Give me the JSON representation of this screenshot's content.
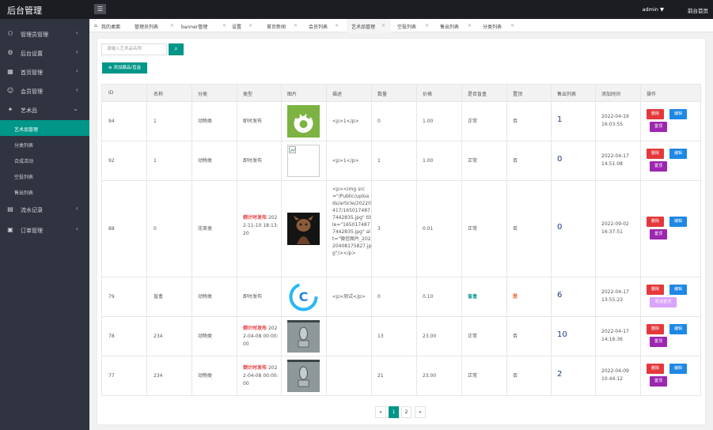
{
  "header": {
    "logo": "后台管理",
    "menu_icon": "☰",
    "user": "admin",
    "user_arrow": "▼",
    "home": "前台首页"
  },
  "sidebar": {
    "items": [
      {
        "icon": "⚇",
        "label": "管理员管理",
        "arrow": "‹"
      },
      {
        "icon": "⚙",
        "label": "后台设置",
        "arrow": "‹"
      },
      {
        "icon": "▦",
        "label": "首页管理",
        "arrow": "‹"
      },
      {
        "icon": "☺",
        "label": "会员管理",
        "arrow": "‹"
      },
      {
        "icon": "✦",
        "label": "艺术品",
        "arrow": "⌄"
      }
    ],
    "sub": [
      {
        "label": "艺术品管理"
      },
      {
        "label": "分类列表"
      },
      {
        "label": "合成活动"
      },
      {
        "label": "空投列表"
      },
      {
        "label": "售出列表"
      }
    ],
    "items2": [
      {
        "icon": "▤",
        "label": "流水记录",
        "arrow": "‹"
      },
      {
        "icon": "▣",
        "label": "订单管理",
        "arrow": "‹"
      }
    ]
  },
  "tabs": [
    {
      "label": "我的桌面",
      "home_icon": "⌂",
      "close": ""
    },
    {
      "label": "管理员列表",
      "close": "✕"
    },
    {
      "label": "banner管理",
      "close": "✕"
    },
    {
      "label": "设置",
      "close": "✕"
    },
    {
      "label": "首页新闻",
      "close": "✕"
    },
    {
      "label": "会员列表",
      "close": "✕"
    },
    {
      "label": "艺术品管理",
      "close": "✕"
    },
    {
      "label": "空投列表",
      "close": "✕"
    },
    {
      "label": "售出列表",
      "close": "✕"
    },
    {
      "label": "分类列表",
      "close": "✕"
    }
  ],
  "search": {
    "placeholder": "请输入艺术品名称",
    "button_icon": "⌕"
  },
  "add_button": "⊕ 添加藏品/盲盒",
  "columns": [
    "ID",
    "名称",
    "分类",
    "类型",
    "图片",
    "描述",
    "数量",
    "价格",
    "是否盲盒",
    "置顶",
    "售出列表",
    "添加时间",
    "操作"
  ],
  "rows": [
    {
      "id": "94",
      "name": "1",
      "category": "动物类",
      "type_timer": "",
      "type": "即时发布",
      "desc": "<p>1</p>",
      "qty": "0",
      "price": "1.00",
      "blind": "正常",
      "top": "否",
      "sold": "1",
      "time": "2022-04-19 16:03:55",
      "btn_del": "删除",
      "btn_edit": "编辑",
      "btn_top": "置顶",
      "image": "paw-logo-image"
    },
    {
      "id": "92",
      "name": "1",
      "category": "动物类",
      "type_timer": "",
      "type": "即时发布",
      "desc": "<p>1</p>",
      "qty": "1",
      "price": "1.00",
      "blind": "正常",
      "top": "否",
      "sold": "0",
      "time": "2022-04-17 14:51:08",
      "btn_del": "删除",
      "btn_edit": "编辑",
      "btn_top": "置顶",
      "image": "broken-image"
    },
    {
      "id": "88",
      "name": "0",
      "category": "花草类",
      "type_timer": "倒计时发布",
      "type": "2022-11-10 18:13:20",
      "desc": "<p><img src=\"/Public/uploads/article/20220417/1650174877442835.jpg\" title=\"1650174877442835.jpg\" alt=\"微信图片_20220408175827.jpg\"/></p>",
      "qty": "3",
      "price": "0.01",
      "blind": "正常",
      "top": "否",
      "sold": "0",
      "time": "2022-09-02 16:37:51",
      "btn_del": "删除",
      "btn_edit": "编辑",
      "btn_top": "置顶",
      "image": "character-image"
    },
    {
      "id": "79",
      "name": "盲盒",
      "category": "动物类",
      "type_timer": "",
      "type": "即时发布",
      "desc": "<p>测试</p>",
      "qty": "0",
      "price": "0.10",
      "blind": "盲盒",
      "top": "是",
      "sold": "6",
      "time": "2022-04-17 13:55:23",
      "btn_del": "删除",
      "btn_edit": "编辑",
      "btn_top": "取消置顶",
      "image": "c-logo-image"
    },
    {
      "id": "78",
      "name": "234",
      "category": "动物类",
      "type_timer": "倒计时发布",
      "type": "2022-04-08 00:00:00",
      "desc": "",
      "qty": "13",
      "price": "23.00",
      "blind": "正常",
      "top": "否",
      "sold": "10",
      "time": "2022-04-17 14:16:36",
      "btn_del": "删除",
      "btn_edit": "编辑",
      "btn_top": "置顶",
      "image": "statue-image"
    },
    {
      "id": "77",
      "name": "234",
      "category": "动物类",
      "type_timer": "倒计时发布",
      "type": "2022-04-08 00:00:00",
      "desc": "",
      "qty": "21",
      "price": "23.00",
      "blind": "正常",
      "top": "否",
      "sold": "2",
      "time": "2022-04-09 10:44:12",
      "btn_del": "删除",
      "btn_edit": "编辑",
      "btn_top": "置顶",
      "image": "statue-image"
    }
  ],
  "pagination": {
    "prev": "«",
    "pages": [
      "1",
      "2"
    ],
    "next": "»"
  },
  "colors": {
    "accent": "#009688",
    "danger": "#e4393c",
    "edit": "#1e88e5",
    "top": "#9c27b0",
    "sidebar": "#2f3440",
    "topbar": "#1b1d22"
  }
}
